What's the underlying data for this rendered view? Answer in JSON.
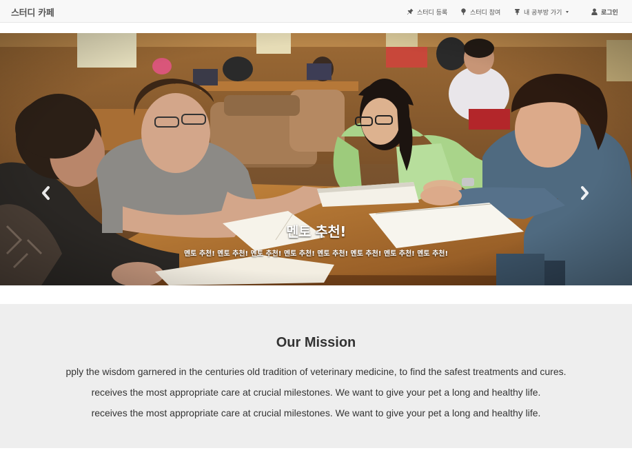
{
  "navbar": {
    "brand": "스터디 카페",
    "items": [
      {
        "label": "스터디 등록",
        "icon": "pushpin-icon"
      },
      {
        "label": "스터디 참여",
        "icon": "tree-icon"
      },
      {
        "label": "내 공부방 가기",
        "icon": "tree-icon",
        "dropdown": true
      }
    ],
    "login": {
      "label": "로그인",
      "icon": "user-icon"
    }
  },
  "carousel": {
    "image": "students-studying-photo",
    "caption_title": "멘토 추천!",
    "caption_text": "멘토 추천! 멘토 추천! 멘토 추천! 멘토 추천! 멘토 추천! 멘토 추천! 멘토 추천! 멘토 추천!",
    "prev_icon": "chevron-left-icon",
    "next_icon": "chevron-right-icon"
  },
  "mission": {
    "title": "Our Mission",
    "lines": [
      "pply the wisdom garnered in the centuries old tradition of veterinary medicine, to find the safest treatments and cures.",
      "receives the most appropriate care at crucial milestones. We want to give your pet a long and healthy life.",
      "receives the most appropriate care at crucial milestones. We want to give your pet a long and healthy life."
    ]
  },
  "colors": {
    "navbar_bg": "#f8f8f8",
    "mission_bg": "#eeeeee",
    "text": "#333333"
  }
}
